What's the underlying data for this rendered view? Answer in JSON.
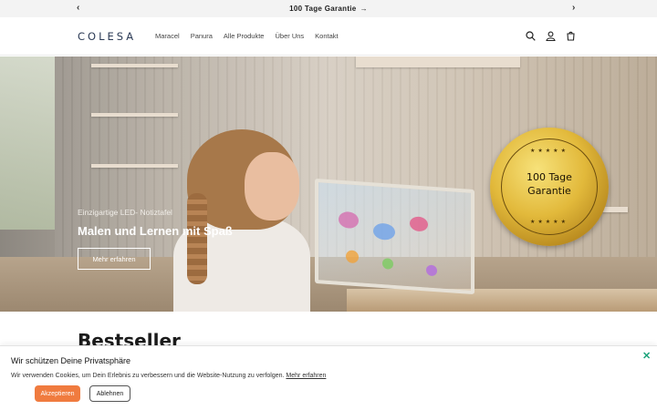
{
  "announcement": {
    "text": "100 Tage Garantie",
    "arrow": "→",
    "prev": "‹",
    "next": "›"
  },
  "header": {
    "logo": "COLESA",
    "nav": [
      "Maracel",
      "Panura",
      "Alle Produkte",
      "Über Uns",
      "Kontakt"
    ],
    "icons": [
      "search-icon",
      "account-icon",
      "cart-icon"
    ]
  },
  "hero": {
    "badge_line1": "100 Tage",
    "badge_line2": "Garantie",
    "badge_stars": "★★★★★",
    "eyebrow": "Einzigartige LED- Notiztafel",
    "title": "Malen und Lernen mit Spaß",
    "button": "Mehr erfahren"
  },
  "section": {
    "title": "Bestseller"
  },
  "cookie": {
    "title": "Wir schützen Deine Privatsphäre",
    "text": "Wir verwenden Cookies, um Dein Erlebnis zu verbessern und die Website-Nutzung zu verfolgen.",
    "link": "Mehr erfahren",
    "accept": "Akzeptieren",
    "reject": "Ablehnen",
    "close": "✕"
  },
  "colors": {
    "accent_button": "#f07b3f",
    "close_icon": "#1aa37a",
    "logo": "#2b3a55",
    "badge_gold": "#e2b93b"
  }
}
